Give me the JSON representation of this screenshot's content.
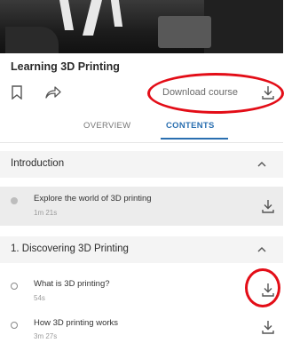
{
  "course": {
    "title": "Learning 3D Printing",
    "download_label": "Download course"
  },
  "tabs": [
    {
      "label": "OVERVIEW",
      "selected": false
    },
    {
      "label": "CONTENTS",
      "selected": true
    }
  ],
  "sections": [
    {
      "title": "Introduction",
      "expanded": true,
      "items": [
        {
          "title": "Explore the world of 3D printing",
          "duration": "1m 21s",
          "active": true
        }
      ]
    },
    {
      "title": "1. Discovering 3D Printing",
      "expanded": true,
      "items": [
        {
          "title": "What is 3D printing?",
          "duration": "54s",
          "active": false
        },
        {
          "title": "How 3D printing works",
          "duration": "3m 27s",
          "active": false
        }
      ]
    }
  ],
  "icons": {
    "bookmark": "bookmark-icon",
    "share": "share-icon",
    "download": "download-icon",
    "collapse": "chevron-up-icon"
  },
  "colors": {
    "accent": "#2a6fb0",
    "annotation": "#e30d17"
  }
}
